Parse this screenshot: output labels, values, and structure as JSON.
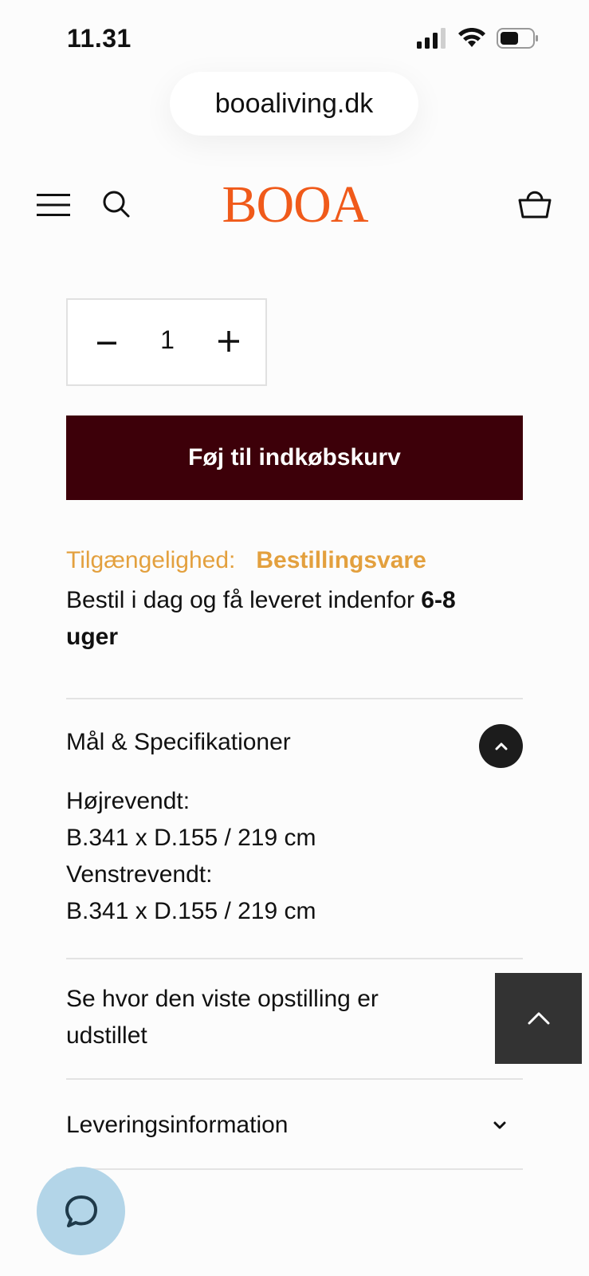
{
  "status_bar": {
    "time": "11.31"
  },
  "browser": {
    "url": "booaliving.dk"
  },
  "header": {
    "logo": "BOOA"
  },
  "quantity": {
    "value": "1"
  },
  "cart_button": {
    "label": "Føj til indkøbskurv"
  },
  "availability": {
    "label": "Tilgængelighed:",
    "value": "Bestillingsvare",
    "delivery_prefix": "Bestil i dag og få leveret indenfor ",
    "delivery_bold": "6-8 uger"
  },
  "accordion": {
    "specs": {
      "title": "Mål & Specifikationer",
      "lines": [
        "Højrevendt:",
        "B.341 x D.155 / 219 cm",
        "Venstrevendt:",
        "B.341 x D.155 / 219 cm"
      ]
    },
    "showroom": {
      "title": "Se hvor den viste opstilling er udstillet"
    },
    "delivery": {
      "title": "Leveringsinformation"
    }
  },
  "colors": {
    "brand": "#f05a1a",
    "cart_button_bg": "#3d0009",
    "availability": "#e3a03e",
    "chat_bg": "#b3d5e8"
  }
}
